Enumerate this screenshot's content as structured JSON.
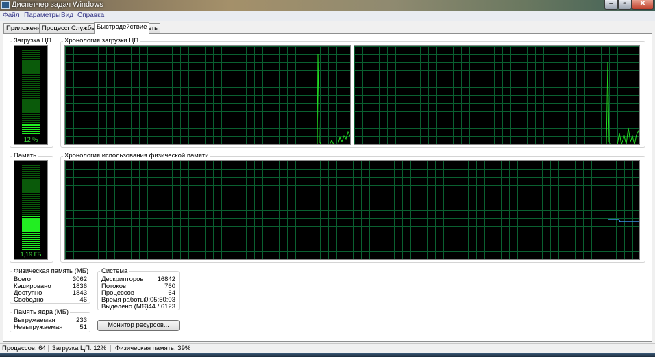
{
  "window": {
    "title": "Диспетчер задач Windows",
    "min_glyph": "‒",
    "max_glyph": "▫",
    "close_glyph": "✕"
  },
  "menu": [
    "Файл",
    "Параметры",
    "Вид",
    "Справка"
  ],
  "tabs": [
    {
      "label": "Приложения",
      "active": false
    },
    {
      "label": "Процессы",
      "active": false
    },
    {
      "label": "Службы",
      "active": false
    },
    {
      "label": "Быстродействие",
      "active": true
    },
    {
      "label": "Сеть",
      "active": false
    }
  ],
  "cpu": {
    "label": "Загрузка ЦП",
    "value_text": "12 %",
    "level": 0.12,
    "history_label": "Хронология загрузки ЦП"
  },
  "memory": {
    "label": "Память",
    "value_text": "1,19 ГБ",
    "level": 0.39,
    "history_label": "Хронология использования физической памяти"
  },
  "physical_memory": {
    "title": "Физическая память (МБ)",
    "rows": [
      {
        "label": "Всего",
        "value": "3062"
      },
      {
        "label": "Кэшировано",
        "value": "1836"
      },
      {
        "label": "Доступно",
        "value": "1843"
      },
      {
        "label": "Свободно",
        "value": "46"
      }
    ]
  },
  "kernel_memory": {
    "title": "Память ядра (МБ)",
    "rows": [
      {
        "label": "Выгружаемая",
        "value": "233"
      },
      {
        "label": "Невыгружаемая",
        "value": "51"
      }
    ]
  },
  "system": {
    "title": "Система",
    "rows": [
      {
        "label": "Дескрипторов",
        "value": "16842"
      },
      {
        "label": "Потоков",
        "value": "760"
      },
      {
        "label": "Процессов",
        "value": "64"
      },
      {
        "label": "Время работы",
        "value": "0:05:50:03"
      },
      {
        "label": "Выделено (МБ)",
        "value": "1344 / 6123"
      }
    ]
  },
  "resource_monitor_button": "Монитор ресурсов...",
  "status": {
    "processes": "Процессов: 64",
    "cpu": "Загрузка ЦП: 12%",
    "memory": "Физическая память: 39%"
  },
  "colors": {
    "graph_grid": "#0a6030",
    "cpu_line": "#22dd22",
    "memory_line": "#3a8fe0"
  }
}
